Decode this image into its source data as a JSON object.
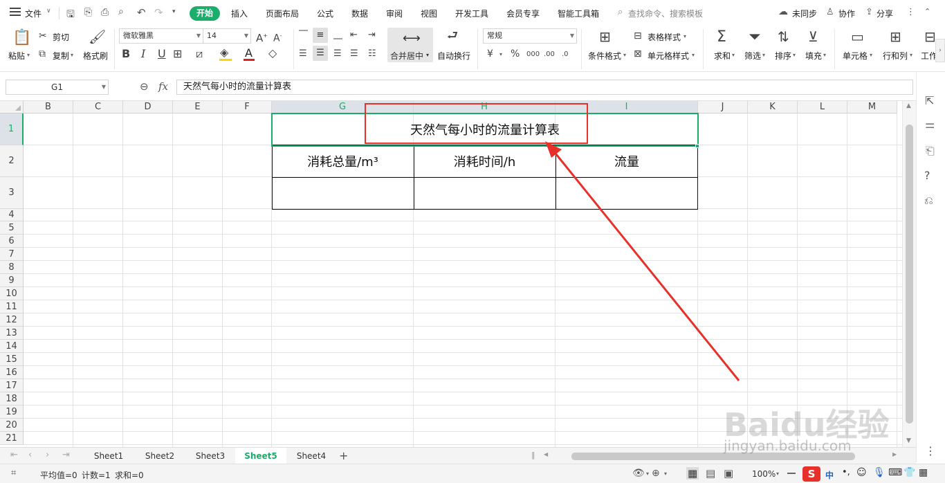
{
  "menubar": {
    "file": "文件",
    "tabs": [
      "开始",
      "插入",
      "页面布局",
      "公式",
      "数据",
      "审阅",
      "视图",
      "开发工具",
      "会员专享",
      "智能工具箱"
    ],
    "search_placeholder": "查找命令、搜索模板",
    "sync": "未同步",
    "collab": "协作",
    "share": "分享"
  },
  "ribbon": {
    "paste": "粘贴",
    "cut": "剪切",
    "copy": "复制",
    "format_painter": "格式刷",
    "font_name": "微软雅黑",
    "font_size": "14",
    "merge_center": "合并居中",
    "wrap_text": "自动换行",
    "number_format": "常规",
    "cond_format": "条件格式",
    "table_style": "表格样式",
    "cell_style": "单元格样式",
    "sum": "求和",
    "filter": "筛选",
    "sort": "排序",
    "fill": "填充",
    "cell": "单元格",
    "row_col": "行和列",
    "worksheet": "工作"
  },
  "formula_bar": {
    "name_box": "G1",
    "fx": "fx",
    "content": "天然气每小时的流量计算表"
  },
  "columns": [
    "B",
    "C",
    "D",
    "E",
    "F",
    "G",
    "H",
    "I",
    "J",
    "K",
    "L",
    "M"
  ],
  "rows": [
    "1",
    "2",
    "3",
    "4",
    "5",
    "6",
    "7",
    "8",
    "9",
    "10",
    "11",
    "12",
    "13",
    "14",
    "15",
    "16",
    "17",
    "18",
    "19",
    "20",
    "21"
  ],
  "table": {
    "title": "天然气每小时的流量计算表",
    "headers": [
      "消耗总量/m³",
      "消耗时间/h",
      "流量"
    ]
  },
  "sheets": [
    "Sheet1",
    "Sheet2",
    "Sheet3",
    "Sheet5",
    "Sheet4"
  ],
  "active_sheet": "Sheet5",
  "status": {
    "average": "平均值=0",
    "count": "计数=1",
    "sum": "求和=0",
    "zoom": "100%",
    "ime": "中"
  },
  "watermark": {
    "brand": "Baidu经验",
    "url": "jingyan.baidu.com"
  },
  "colors": {
    "accent": "#1aad6b",
    "annotation": "#e8302a"
  }
}
